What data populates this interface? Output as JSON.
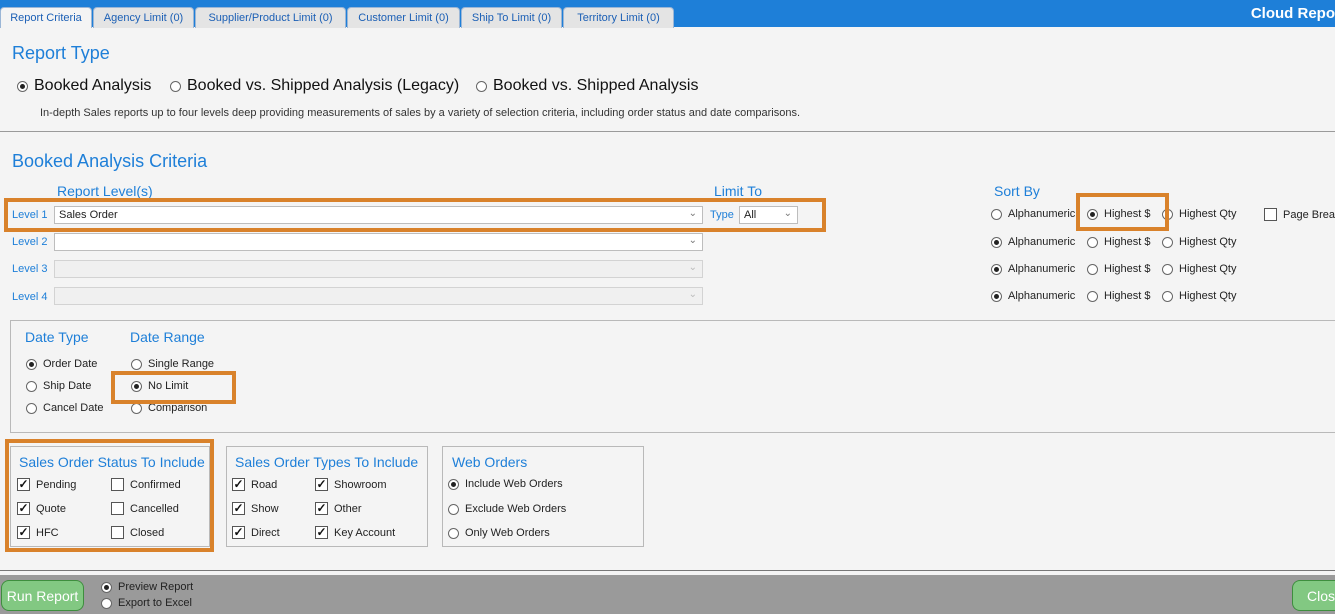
{
  "app_title": "Cloud Repo",
  "tabs": [
    {
      "label": "Report Criteria",
      "active": true
    },
    {
      "label": "Agency Limit (0)"
    },
    {
      "label": "Supplier/Product Limit (0)"
    },
    {
      "label": "Customer Limit (0)"
    },
    {
      "label": "Ship To Limit (0)"
    },
    {
      "label": "Territory Limit (0)"
    }
  ],
  "report_type": {
    "heading": "Report Type",
    "options": [
      {
        "label": "Booked Analysis",
        "selected": true
      },
      {
        "label": "Booked vs. Shipped Analysis (Legacy)",
        "selected": false
      },
      {
        "label": "Booked vs. Shipped Analysis",
        "selected": false
      }
    ],
    "description": "In-depth Sales reports up to four levels deep providing measurements of sales by a variety of selection criteria, including order status and date comparisons."
  },
  "criteria": {
    "heading": "Booked Analysis Criteria",
    "report_levels_label": "Report Level(s)",
    "limit_to_label": "Limit To",
    "sort_by_label": "Sort By",
    "type_label": "Type",
    "type_value": "All",
    "page_break_label": "Page Break",
    "levels": [
      {
        "label": "Level 1",
        "value": "Sales Order",
        "enabled": true,
        "sort": "Highest $"
      },
      {
        "label": "Level 2",
        "value": "",
        "enabled": true,
        "sort": "Alphanumeric"
      },
      {
        "label": "Level 3",
        "value": "",
        "enabled": false,
        "sort": "Alphanumeric"
      },
      {
        "label": "Level 4",
        "value": "",
        "enabled": false,
        "sort": "Alphanumeric"
      }
    ],
    "sort_options": [
      "Alphanumeric",
      "Highest $",
      "Highest Qty"
    ]
  },
  "dates": {
    "date_type_label": "Date Type",
    "date_range_label": "Date Range",
    "date_types": [
      {
        "label": "Order Date",
        "selected": true
      },
      {
        "label": "Ship Date",
        "selected": false
      },
      {
        "label": "Cancel Date",
        "selected": false
      }
    ],
    "date_ranges": [
      {
        "label": "Single Range",
        "selected": false
      },
      {
        "label": "No Limit",
        "selected": true
      },
      {
        "label": "Comparison",
        "selected": false
      }
    ]
  },
  "status": {
    "heading": "Sales Order Status To Include",
    "items": [
      {
        "label": "Pending",
        "checked": true
      },
      {
        "label": "Confirmed",
        "checked": false
      },
      {
        "label": "Quote",
        "checked": true
      },
      {
        "label": "Cancelled",
        "checked": false
      },
      {
        "label": "HFC",
        "checked": true
      },
      {
        "label": "Closed",
        "checked": false
      }
    ]
  },
  "types": {
    "heading": "Sales Order Types To Include",
    "items": [
      {
        "label": "Road",
        "checked": true
      },
      {
        "label": "Showroom",
        "checked": true
      },
      {
        "label": "Show",
        "checked": true
      },
      {
        "label": "Other",
        "checked": true
      },
      {
        "label": "Direct",
        "checked": true
      },
      {
        "label": "Key Account",
        "checked": true
      }
    ]
  },
  "web_orders": {
    "heading": "Web Orders",
    "options": [
      {
        "label": "Include Web Orders",
        "selected": true
      },
      {
        "label": "Exclude Web Orders",
        "selected": false
      },
      {
        "label": "Only Web Orders",
        "selected": false
      }
    ]
  },
  "footer": {
    "run_label": "Run Report",
    "close_label": "Clos",
    "output_options": [
      {
        "label": "Preview Report",
        "selected": true
      },
      {
        "label": "Export to Excel",
        "selected": false
      }
    ]
  },
  "colors": {
    "accent": "#1e7fd8",
    "highlight": "#d9822b",
    "button": "#82c882"
  }
}
